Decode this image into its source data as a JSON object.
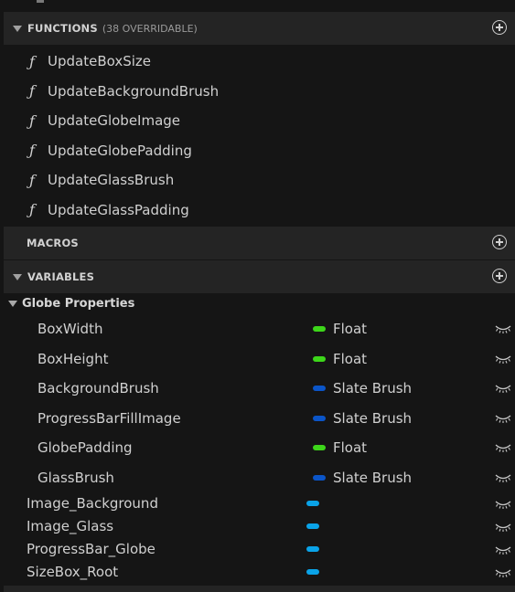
{
  "functions": {
    "title": "FUNCTIONS",
    "subtitle": "(38 OVERRIDABLE)",
    "items": [
      {
        "icon": "function-icon",
        "label": "UpdateBoxSize"
      },
      {
        "icon": "function-icon",
        "label": "UpdateBackgroundBrush"
      },
      {
        "icon": "function-icon",
        "label": "UpdateGlobeImage"
      },
      {
        "icon": "function-icon",
        "label": "UpdateGlobePadding"
      },
      {
        "icon": "function-icon",
        "label": "UpdateGlassBrush"
      },
      {
        "icon": "function-icon",
        "label": "UpdateGlassPadding"
      }
    ]
  },
  "macros": {
    "title": "MACROS"
  },
  "variables": {
    "title": "VARIABLES",
    "category": "Globe Properties",
    "category_items": [
      {
        "name": "BoxWidth",
        "type": "Float",
        "color": "#3dd61a"
      },
      {
        "name": "BoxHeight",
        "type": "Float",
        "color": "#3dd61a"
      },
      {
        "name": "BackgroundBrush",
        "type": "Slate Brush",
        "color": "#0b55c8"
      },
      {
        "name": "ProgressBarFillImage",
        "type": "Slate Brush",
        "color": "#0b55c8"
      },
      {
        "name": "GlobePadding",
        "type": "Float",
        "color": "#3dd61a"
      },
      {
        "name": "GlassBrush",
        "type": "Slate Brush",
        "color": "#0b55c8"
      }
    ],
    "widget_items": [
      {
        "name": "Image_Background",
        "color": "#0aa3e8"
      },
      {
        "name": "Image_Glass",
        "color": "#0aa3e8"
      },
      {
        "name": "ProgressBar_Globe",
        "color": "#0aa3e8"
      },
      {
        "name": "SizeBox_Root",
        "color": "#0aa3e8"
      }
    ]
  },
  "icons": {
    "function": "f-glyph",
    "add": "plus-circle-icon",
    "visibility": "eye-closed-icon"
  }
}
